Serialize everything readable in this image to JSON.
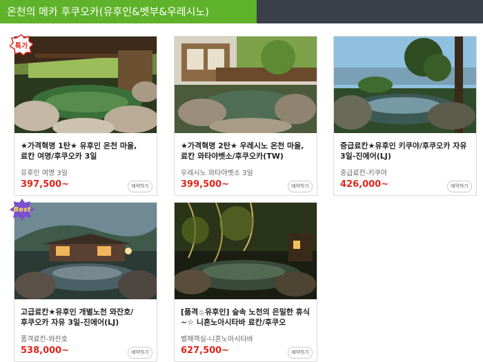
{
  "header": {
    "title": "온천의 메카 후쿠오카(유후인&벳부&우레시노)"
  },
  "colors": {
    "header_green": "#5fb32a",
    "header_dark": "#3a3f4a",
    "price_red": "#e0251b"
  },
  "cards": [
    {
      "badge": "특가",
      "title": "★가격혁명 1탄★ 유후인 온천 마을, 료칸 여명/후쿠오카 3일",
      "sub": "유후인 여명 3일",
      "price": "397,500~",
      "reserve": "예약하기"
    },
    {
      "badge": "",
      "title": "★가격혁명 2탄★ 우레시노 온천 마을, 료칸 와타야벳소/후쿠오카(TW)",
      "sub": "우레시노 와타야벳소 3일",
      "price": "399,500~",
      "reserve": "예약하기"
    },
    {
      "badge": "",
      "title": "중급료칸★유후인 키쿠야/후쿠오카 자유 3일-진에어(LJ)",
      "sub": "중급료칸-키쿠야",
      "price": "426,000~",
      "reserve": "예약하기"
    },
    {
      "badge": "Best",
      "title": "고급료칸★유후인 개별노천 와잔호/후쿠오카 자유 3일-진에어(LJ)",
      "sub": "품격료칸-와잔호",
      "price": "538,000~",
      "reserve": "예약하기"
    },
    {
      "badge": "",
      "title": "[품격♨유후인] 숲속 노천의 은밀한 휴식~☆ 니혼노아시타바 료칸/후쿠오",
      "sub": "별채객실-니혼노아시타바",
      "price": "627,500~",
      "reserve": "예약하기"
    }
  ]
}
